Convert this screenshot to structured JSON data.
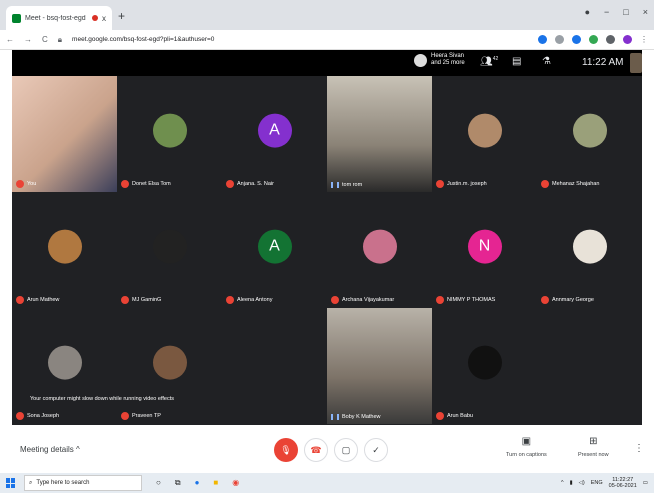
{
  "browser": {
    "tab_title": "Meet - bsq-fost-egd",
    "tab_close": "x",
    "new_tab": "+",
    "url": "meet.google.com/bsq-fost-egd?pli=1&authuser=0",
    "nav_back": "←",
    "nav_forward": "→",
    "reload": "C",
    "window_controls": {
      "minimize": "−",
      "maximize": "□",
      "close": "×"
    }
  },
  "meet_topbar": {
    "presenter_line1": "Heera Sivan",
    "presenter_line2": "and 25 more",
    "people_count": "42",
    "clock": "11:22 AM"
  },
  "participants": [
    {
      "name": "You",
      "kind": "video",
      "mic": "muted"
    },
    {
      "name": "Donet Elsa Tom",
      "kind": "photo",
      "color": "#6f8f4e",
      "mic": "muted"
    },
    {
      "name": "Anjana. S. Nair",
      "kind": "letter",
      "letter": "A",
      "color": "#8430ce",
      "mic": "muted"
    },
    {
      "name": "tom rom",
      "kind": "video",
      "mic": "speaking"
    },
    {
      "name": "Justin.m. joseph",
      "kind": "photo",
      "color": "#b08a6a",
      "mic": "muted"
    },
    {
      "name": "Mehanaz Shajahan",
      "kind": "photo",
      "color": "#9aa07a",
      "mic": "muted"
    },
    {
      "name": "Arun Mathew",
      "kind": "photo",
      "color": "#b07840",
      "mic": "muted"
    },
    {
      "name": "MJ GaminG",
      "kind": "photo",
      "color": "#222222",
      "mic": "muted"
    },
    {
      "name": "Aleena Antony",
      "kind": "letter",
      "letter": "A",
      "color": "#137333",
      "mic": "muted"
    },
    {
      "name": "Archana Vijayakumar",
      "kind": "photo",
      "color": "#c9718c",
      "mic": "muted"
    },
    {
      "name": "NIMMY P THOMAS",
      "kind": "letter",
      "letter": "N",
      "color": "#e52592",
      "mic": "muted"
    },
    {
      "name": "Annmary George",
      "kind": "photo",
      "color": "#e8e2d8",
      "mic": "muted"
    },
    {
      "name": "Sona Joseph",
      "kind": "photo",
      "color": "#8a8580",
      "mic": "muted"
    },
    {
      "name": "Praveen TP",
      "kind": "photo",
      "color": "#7a5840",
      "mic": "muted"
    },
    {
      "name": "Boby K Mathew",
      "kind": "video",
      "mic": "speaking"
    },
    {
      "name": "Arun Babu",
      "kind": "photo",
      "color": "#111111",
      "mic": "muted"
    }
  ],
  "toast": "Your computer might slow down while running video effects",
  "bottom_bar": {
    "meeting_details": "Meeting details",
    "captions_label": "Turn on captions",
    "present_label": "Present now"
  },
  "taskbar": {
    "search_placeholder": "Type here to search",
    "time": "11:22:27",
    "date": "05-06-2021",
    "lang": "ENG"
  },
  "colors": {
    "meet_bg": "#202124",
    "mic_muted": "#ea4335",
    "accent": "#1a73e8"
  }
}
